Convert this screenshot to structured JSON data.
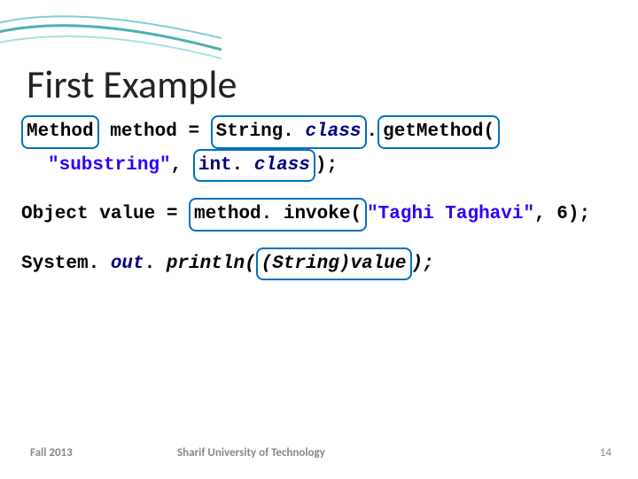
{
  "title": "First Example",
  "code": {
    "l1_seg1": "Method",
    "l1_seg2": " method = ",
    "l1_seg3": "String.",
    "l1_seg3b": " class",
    "l1_seg4": ".",
    "l1_seg5": "getMethod(",
    "l2_seg1": "\"substring\"",
    "l2_seg2": ", ",
    "l2_seg3_a": "int",
    "l2_seg3_b": ".",
    "l2_seg3_c": " class",
    "l2_seg4": ");",
    "l3_seg1": "Object value = ",
    "l3_seg2": "method. invoke(",
    "l3_seg3": "\"Taghi Taghavi\"",
    "l3_seg4": ", 6);",
    "l4_seg1": "System.",
    "l4_seg2": " out",
    "l4_seg3": ".",
    "l4_seg4": " println(",
    "l4_seg5": "(String)value",
    "l4_seg6": ");"
  },
  "footer": {
    "left": "Fall 2013",
    "mid": "Sharif University of Technology",
    "right": "14"
  }
}
